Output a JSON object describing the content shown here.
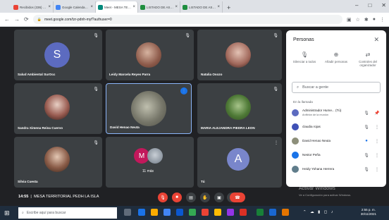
{
  "browser": {
    "tabs": [
      {
        "label": "Recibidos (336) - fvmendalis",
        "color": "#ea4335"
      },
      {
        "label": "Google Calendar - martes, 3",
        "color": "#4285f4"
      },
      {
        "label": "Meet - MESA TERRITORI",
        "color": "#00897b",
        "active": true
      },
      {
        "label": "LISTADO DE ASISTENCIA M.",
        "color": "#1e8e3e"
      },
      {
        "label": "LISTADO DE ASISTENCIA M.",
        "color": "#1e8e3e"
      }
    ],
    "new_tab": "+",
    "url": "meet.google.com/tzr-pdnh-myf?authuser=0",
    "window_controls": [
      "–",
      "□",
      "✕"
    ]
  },
  "tiles": [
    {
      "name": "Salud Ambiental SurOcc",
      "initial": "S",
      "avatar_color": "#5c6bc0"
    },
    {
      "name": "Leidy Marcela Reyes Parra",
      "avatar_color": "#9e7b6b"
    },
    {
      "name": "Natalia Osozo",
      "avatar_color": "#c48f86"
    },
    {
      "name": "Sandra Ximena Reina Cuervo",
      "avatar_color": "#a1887f"
    },
    {
      "name": "David Henao Neuta",
      "avatar_color": "#8d8f7a"
    },
    {
      "name": "MARIA ALEJANDRA PIEDRA LEON",
      "avatar_color": "#6d8f4e"
    },
    {
      "name": "Silvia Cuesta",
      "avatar_color": "#b08a72"
    },
    {
      "name": "11 más",
      "initial": "M",
      "avatar_color": "#c2185b"
    },
    {
      "name": "Tú",
      "initial": "A",
      "avatar_color": "#7986cb"
    }
  ],
  "people_panel": {
    "title": "Personas",
    "actions": [
      "Silenciar a todos",
      "Añadir personas",
      "Controles del organizador"
    ],
    "search_placeholder": "Buscar a gente",
    "section": "En la llamada",
    "people": [
      {
        "name": "Administrador Hume... (Tú)",
        "sub": "Anfitrión de la reunión",
        "color": "#5c6bc0"
      },
      {
        "name": "claudia rojas",
        "color": "#3f51b5"
      },
      {
        "name": "David Henao Neuta",
        "color": "#8d8f7a"
      },
      {
        "name": "Nestor Peña",
        "color": "#1a73e8"
      },
      {
        "name": "Heidy Yohana Herrera",
        "color": "#607d8b"
      }
    ]
  },
  "meeting": {
    "time": "14:55",
    "title": "MESA TERRITORIAL PEDH LA ISLA"
  },
  "watermark": {
    "title": "Activar Windows",
    "text": "Ve a Configuración para activar Windows."
  },
  "taskbar": {
    "search_placeholder": "Escribe aquí para buscar",
    "time": "2:55 p. m.",
    "date": "30/11/2021"
  }
}
